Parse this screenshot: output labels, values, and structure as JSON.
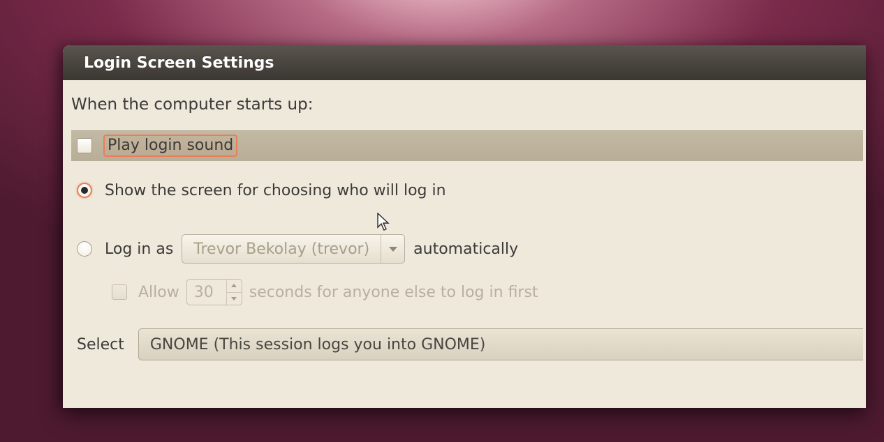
{
  "window": {
    "title": "Login Screen Settings"
  },
  "heading": "When the computer starts up:",
  "play_sound": {
    "label": "Play login sound",
    "checked": false
  },
  "login_mode": {
    "show_chooser": {
      "label": "Show the screen for choosing who will log in",
      "selected": true
    },
    "auto": {
      "prefix": "Log in as",
      "user": "Trevor Bekolay (trevor)",
      "suffix": "automatically",
      "selected": false
    }
  },
  "allow_delay": {
    "prefix": "Allow",
    "seconds": "30",
    "suffix": "seconds for anyone else to log in first",
    "enabled": false
  },
  "session": {
    "label": "Select",
    "value": "GNOME (This session logs you into GNOME)"
  }
}
